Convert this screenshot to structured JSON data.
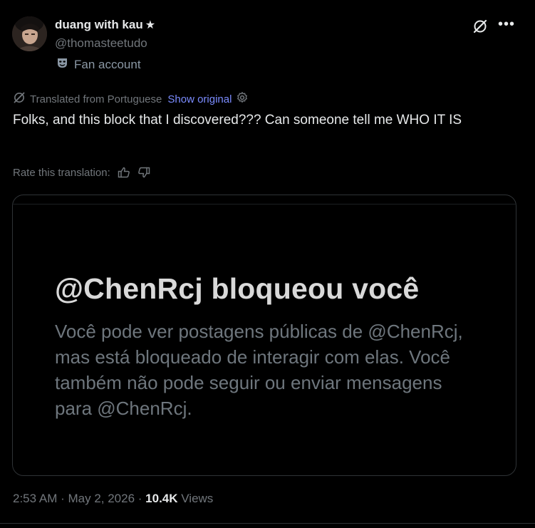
{
  "author": {
    "display_name": "duang with kau",
    "star_glyph": "★",
    "handle": "@thomasteetudo",
    "fan_label": "Fan account"
  },
  "translation": {
    "label": "Translated from Portuguese",
    "show_original": "Show original",
    "rate_label": "Rate this translation:"
  },
  "tweet": {
    "text": "Folks, and this block that I discovered??? Can someone tell me WHO IT IS"
  },
  "media": {
    "title": "@ChenRcj bloqueou você",
    "description": "Você pode ver postagens públicas de @ChenRcj, mas está bloqueado de interagir com elas. Você também não pode seguir ou enviar mensagens para @ChenRcj."
  },
  "meta": {
    "time": "2:53 AM",
    "separator": " · ",
    "date": "May 2, 2026",
    "views_count": "10.4K",
    "views_label": "Views"
  },
  "icons": {
    "header": [
      "grok-icon",
      "more-icon"
    ],
    "fan": "theater-mask-icon",
    "translate": "translate-icon",
    "settings": "gear-icon",
    "rate": [
      "thumbs-up-icon",
      "thumbs-down-icon"
    ]
  },
  "colors": {
    "background": "#000000",
    "text": "#e7e9ea",
    "muted": "#71767b",
    "link": "#7b8cff",
    "border": "#2f3336"
  }
}
